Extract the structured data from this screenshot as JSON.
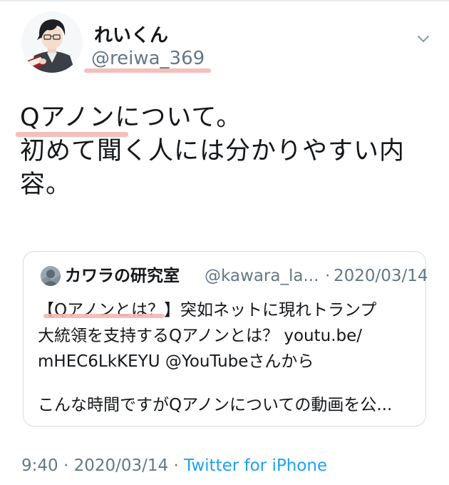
{
  "tweet": {
    "display_name": "れいくん",
    "handle": "@reiwa_369",
    "text": "Qアノンについて。\n初めて聞く人には分かりやすい内\n容。",
    "time": "9:40",
    "separator": "·",
    "date": "2020/03/14",
    "source": "Twitter for iPhone"
  },
  "quote": {
    "display_name": "カワラの研究室",
    "handle": "@kawara_la...",
    "separator": "·",
    "date": "2020/03/14",
    "text": "【Qアノンとは？】突如ネットに現れトランプ\n大統領を支持するQアノンとは？ youtu.be/\nmHEC6LkKEYU @YouTubeさんから",
    "text2": "こんな時間ですがQアノンについての動画を公..."
  },
  "icons": {
    "menu": "chevron-down-icon",
    "avatar": "user-avatar-illustration",
    "quote_avatar": "quote-user-avatar"
  },
  "colors": {
    "text": "#14171a",
    "muted": "#657786",
    "link": "#1da1f2",
    "highlight": "#f3b8b4"
  }
}
